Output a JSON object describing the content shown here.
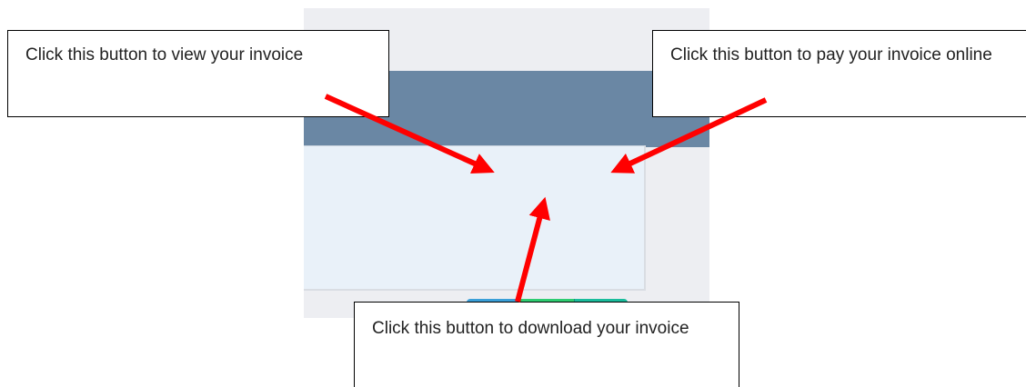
{
  "invoice_actions": {
    "view_icon": "eye-icon",
    "download_icon": "download-icon",
    "pay_icon": "dollar-icon",
    "pay_symbol": "$",
    "colors": {
      "view": "#3a9fd8",
      "download": "#2ecc71",
      "pay": "#1abc9c",
      "header": "#6a87a4",
      "body": "#e9f1f9"
    }
  },
  "callouts": {
    "view": "Click this button to view your invoice",
    "pay": "Click this button to pay your invoice online",
    "download": "Click this button to download your invoice"
  },
  "annotation_color": "#ff0000"
}
